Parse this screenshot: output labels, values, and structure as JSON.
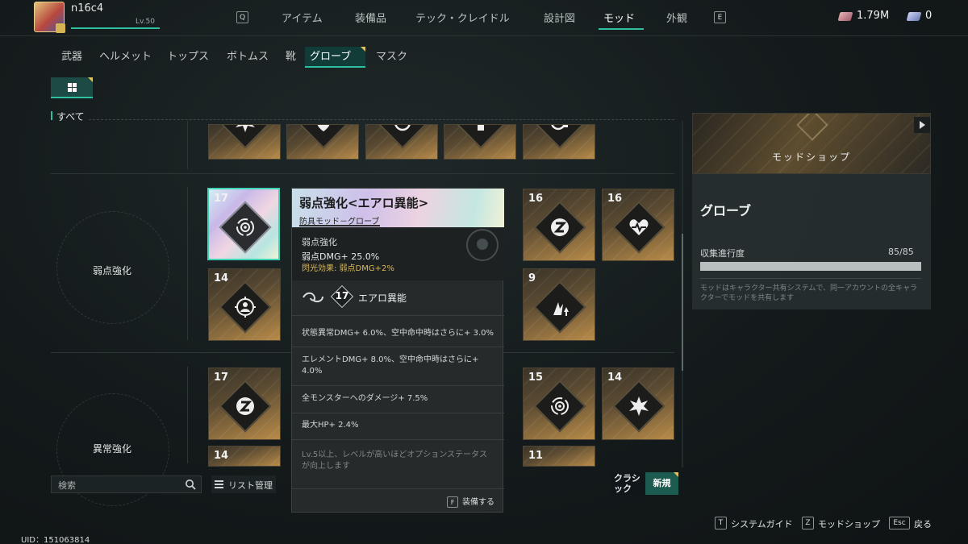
{
  "player": {
    "name": "n16c4",
    "level": "Lv.50",
    "xp_fraction": 1.0
  },
  "top_nav": {
    "key_left": "Q",
    "key_right": "E",
    "tabs": [
      "アイテム",
      "装備品",
      "テック・クレイドル",
      "設計図",
      "モッド",
      "外観"
    ],
    "active": "モッド"
  },
  "currency": {
    "primary": "1.79M",
    "secondary": "0"
  },
  "category_tabs": [
    "武器",
    "ヘルメット",
    "トップス",
    "ボトムス",
    "靴",
    "グローブ",
    "マスク"
  ],
  "active_category": "グローブ",
  "filter_label": "すべて",
  "groups": [
    {
      "label": "弱点強化"
    },
    {
      "label": "異常強化"
    }
  ],
  "cards": {
    "row1": [
      {
        "level": "17",
        "icon": "aero-swirl-icon",
        "selected": true
      },
      {
        "level": "16",
        "icon": "z-rune-icon"
      },
      {
        "level": "16",
        "icon": "heart-pulse-icon"
      }
    ],
    "row2": [
      {
        "level": "14",
        "icon": "target-person-icon"
      },
      {
        "level": "9",
        "icon": "flame-up-icon"
      }
    ],
    "row3": [
      {
        "level": "17",
        "icon": "z-rune-icon"
      },
      {
        "level": "15",
        "icon": "aero-swirl-icon"
      },
      {
        "level": "14",
        "icon": "burst-icon"
      }
    ],
    "row4": [
      {
        "level": "14"
      },
      {
        "level": "11"
      }
    ]
  },
  "tooltip": {
    "title": "弱点強化<エアロ異能>",
    "subtitle": "防具モッド－グローブ",
    "stat_name": "弱点強化",
    "stat_value": "弱点DMG+ 25.0%",
    "flash_effect": "閃光効果: 弱点DMG+2%",
    "set_level": "17",
    "set_name": "エアロ異能",
    "options": [
      "状態異常DMG+ 6.0%、空中命中時はさらに+ 3.0%",
      "エレメントDMG+ 8.0%、空中命中時はさらに+ 4.0%",
      "全モンスターへのダメージ+ 7.5%",
      "最大HP+ 2.4%"
    ],
    "note": "Lv.5以上、レベルが高いほどオプションステータスが向上します",
    "equip_key": "F",
    "equip_label": "装備する"
  },
  "search": {
    "placeholder": "検索"
  },
  "list_manage": "リスト管理",
  "sort": {
    "classic": "クラシック",
    "new": "新規"
  },
  "shop": {
    "label": "モッドショップ"
  },
  "panel": {
    "title": "グローブ",
    "progress_label": "収集進行度",
    "progress_value": "85/85",
    "progress_fraction": 1.0,
    "description": "モッドはキャラクター共有システムで、同一アカウントの全キャラクターでモッドを共有します"
  },
  "footer": {
    "items": [
      {
        "key": "T",
        "label": "システムガイド"
      },
      {
        "key": "Z",
        "label": "モッドショップ"
      },
      {
        "key": "Esc",
        "label": "戻る"
      }
    ],
    "uid": "UID：151063814"
  },
  "colors": {
    "accent": "#2fbfa0",
    "gold": "#d9b85a",
    "holo": "#cfc0ea"
  }
}
